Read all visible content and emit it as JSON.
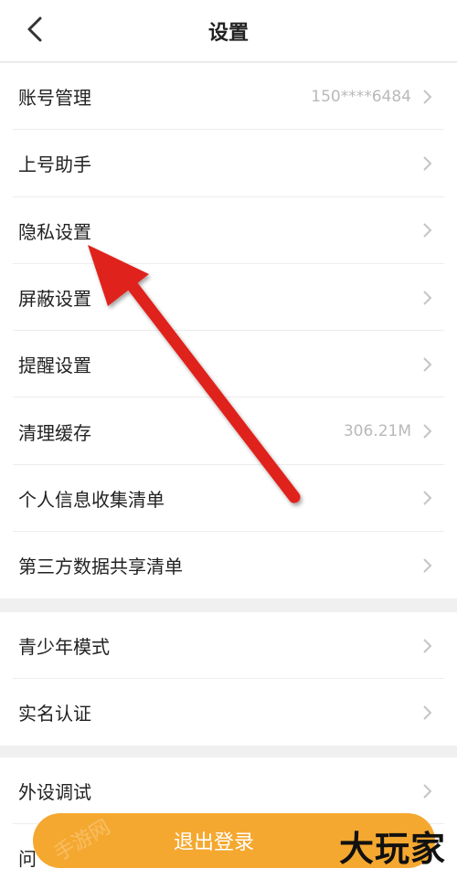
{
  "header": {
    "title": "设置"
  },
  "groups": {
    "main": [
      {
        "label": "账号管理",
        "value": "150****6484"
      },
      {
        "label": "上号助手"
      },
      {
        "label": "隐私设置"
      },
      {
        "label": "屏蔽设置"
      },
      {
        "label": "提醒设置"
      },
      {
        "label": "清理缓存",
        "value": "306.21M"
      },
      {
        "label": "个人信息收集清单"
      },
      {
        "label": "第三方数据共享清单"
      }
    ],
    "second": [
      {
        "label": "青少年模式"
      },
      {
        "label": "实名认证"
      }
    ],
    "third": [
      {
        "label": "外设调试"
      },
      {
        "label": "问"
      }
    ]
  },
  "footer": {
    "logout_label": "退出登录"
  },
  "watermark": {
    "text": "大玩家",
    "faint": "手游网"
  },
  "colors": {
    "accent": "#f5a830",
    "arrow": "#e0201b"
  }
}
